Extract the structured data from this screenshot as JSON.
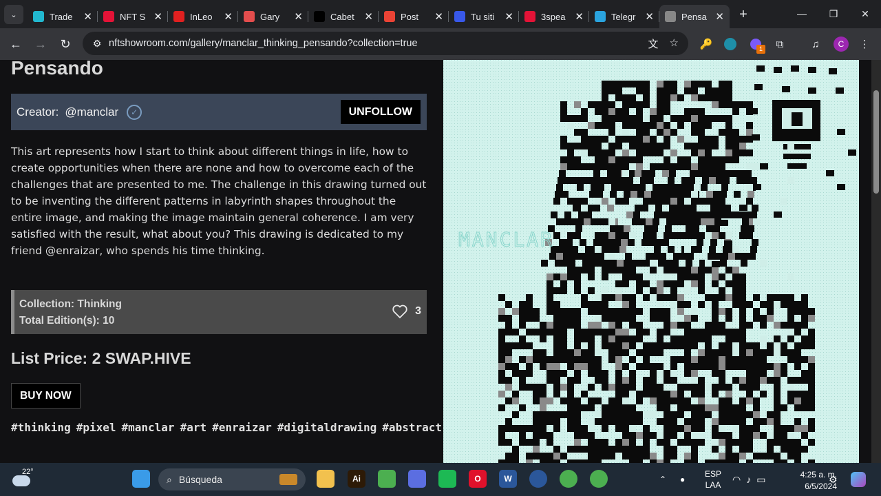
{
  "browser": {
    "tabs": [
      {
        "title": "Trade",
        "icon": "swap-icon",
        "color": "#22b8cf"
      },
      {
        "title": "NFT S",
        "icon": "hive-icon",
        "color": "#e31337"
      },
      {
        "title": "InLeo",
        "icon": "leo-icon",
        "color": "#e02020"
      },
      {
        "title": "Gary",
        "icon": "peakd-icon",
        "color": "#e34d4d"
      },
      {
        "title": "Cabet",
        "icon": "x-icon",
        "color": "#000000"
      },
      {
        "title": "Post",
        "icon": "gmail-icon",
        "color": "#ea4335"
      },
      {
        "title": "Tu siti",
        "icon": "wordpress-icon",
        "color": "#3858e9"
      },
      {
        "title": "3spea",
        "icon": "3speak-icon",
        "color": "#e31337"
      },
      {
        "title": "Telegr",
        "icon": "telegram-icon",
        "color": "#2aa3de"
      },
      {
        "title": "Pensa",
        "icon": "nftshowroom-icon",
        "color": "#888888",
        "active": true
      }
    ],
    "url": "nftshowroom.com/gallery/manclar_thinking_pensando?collection=true",
    "profile_letter": "C",
    "extension_badge": "1"
  },
  "page": {
    "title": "Pensando",
    "creator_label": "Creator:",
    "creator_handle": "@manclar",
    "unfollow_label": "UNFOLLOW",
    "description": "This art represents how I start to think about different things in life, how to create opportunities when there are none and how to overcome each of the challenges that are presented to me. The challenge in this drawing turned out to be inventing the different patterns in labyrinth shapes throughout the entire image, and making the image maintain general coherence. I am very satisfied with the result, what about you? This drawing is dedicated to my friend @enraizar, who spends his time thinking.",
    "collection": "Collection: Thinking",
    "editions": "Total Edition(s): 10",
    "likes": "3",
    "price": "List Price: 2 SWAP.HIVE",
    "buy_label": "BUY NOW",
    "tags": [
      "#thinking",
      "#pixel",
      "#manclar",
      "#art",
      "#enraizar",
      "#digitaldrawing",
      "#abstract"
    ],
    "art_watermark": "MANCLAR"
  },
  "taskbar": {
    "temperature": "22°",
    "search_placeholder": "Búsqueda",
    "lang_top": "ESP",
    "lang_bottom": "LAA",
    "time": "4:25 a. m.",
    "date": "6/5/2024",
    "apps": [
      {
        "name": "windows-start-icon",
        "label": "",
        "color": "#3a9be8"
      },
      {
        "name": "file-explorer-icon",
        "label": "",
        "color": "#f2c14e"
      },
      {
        "name": "illustrator-icon",
        "label": "Ai",
        "color": "#2d1a06"
      },
      {
        "name": "chrome-icon",
        "label": "",
        "color": "#4caf50"
      },
      {
        "name": "copilot-icon",
        "label": "",
        "color": "#5b6ee1"
      },
      {
        "name": "spotify-icon",
        "label": "",
        "color": "#1db954"
      },
      {
        "name": "opera-icon",
        "label": "O",
        "color": "#e0112b"
      },
      {
        "name": "word-icon",
        "label": "W",
        "color": "#2b579a"
      }
    ]
  }
}
